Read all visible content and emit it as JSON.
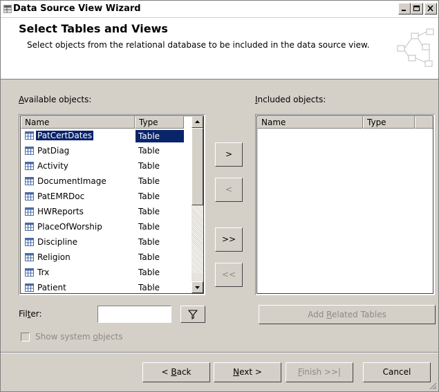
{
  "window": {
    "title": "Data Source View Wizard"
  },
  "header": {
    "title": "Select Tables and Views",
    "subtitle": "Select objects from the relational database to be included in the data source view."
  },
  "available": {
    "label_mnemonic": "A",
    "label_rest": "vailable objects:",
    "columns": [
      "Name",
      "Type"
    ],
    "rows": [
      {
        "name": "PatCertDates",
        "type": "Table",
        "selected": true
      },
      {
        "name": "PatDiag",
        "type": "Table"
      },
      {
        "name": "Activity",
        "type": "Table"
      },
      {
        "name": "DocumentImage",
        "type": "Table"
      },
      {
        "name": "PatEMRDoc",
        "type": "Table"
      },
      {
        "name": "HWReports",
        "type": "Table"
      },
      {
        "name": "PlaceOfWorship",
        "type": "Table"
      },
      {
        "name": "Discipline",
        "type": "Table"
      },
      {
        "name": "Religion",
        "type": "Table"
      },
      {
        "name": "Trx",
        "type": "Table"
      },
      {
        "name": "Patient",
        "type": "Table"
      }
    ]
  },
  "included": {
    "label_mnemonic": "I",
    "label_rest": "ncluded objects:",
    "columns": [
      "Name",
      "Type"
    ]
  },
  "move_buttons": {
    "add": ">",
    "remove": "<",
    "add_all": ">>",
    "remove_all": "<<"
  },
  "filter": {
    "label_pre": "Fil",
    "label_mnemonic": "t",
    "label_post": "er:",
    "value": ""
  },
  "show_system": {
    "label_pre": "Show system ",
    "label_mnemonic": "o",
    "label_post": "bjects",
    "checked": false
  },
  "add_related": {
    "label_pre": "Add ",
    "label_mnemonic": "R",
    "label_post": "elated Tables"
  },
  "footer": {
    "back": {
      "pre": "< ",
      "mn": "B",
      "post": "ack"
    },
    "next": {
      "pre": "",
      "mn": "N",
      "post": "ext >"
    },
    "finish": {
      "pre": "",
      "mn": "F",
      "post": "inish >>|"
    },
    "cancel": "Cancel"
  }
}
